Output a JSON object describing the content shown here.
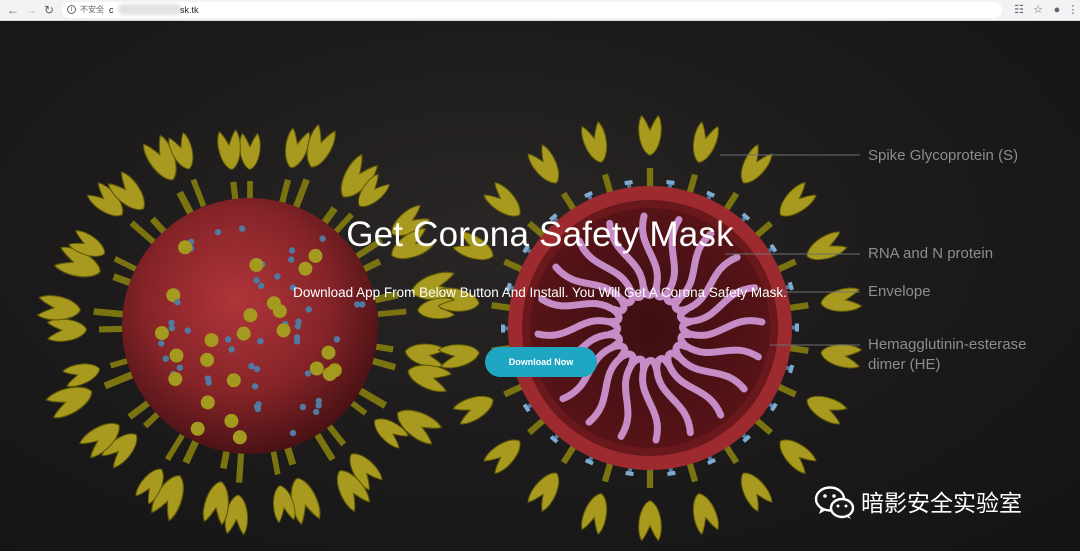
{
  "browser": {
    "security_label": "不安全",
    "url_prefix": "c",
    "url_suffix": "sk.tk",
    "info_glyph": "i"
  },
  "hero": {
    "title": "Get Corona Safety Mask",
    "subtitle": "Download App From Below Button And Install. You Will Get A Corona Safety Mask.",
    "download_label": "Download Now",
    "accent_color": "#1fa6c3"
  },
  "diagram_labels": {
    "spike": "Spike Glycoprotein (S)",
    "rna": "RNA and N protein",
    "envelope": "Envelope",
    "he_line1": "Hemagglutinin-esterase",
    "he_line2": "dimer (HE)"
  },
  "watermark": {
    "text": "暗影安全实验室"
  }
}
